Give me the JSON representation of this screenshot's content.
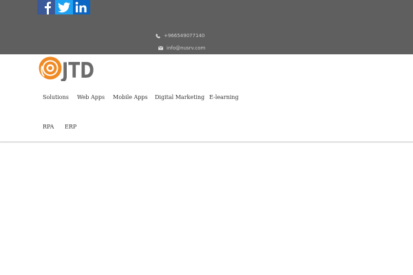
{
  "colors": {
    "topbar_bg": "#5f5f60",
    "facebook": "#3b5998",
    "twitter": "#1da1f2",
    "linkedin": "#0a66c2",
    "logo_orange": "#f08a24",
    "logo_grey": "#6b6b6b",
    "nav_text": "#333333"
  },
  "social": [
    {
      "name": "facebook",
      "icon": "facebook-icon"
    },
    {
      "name": "twitter",
      "icon": "twitter-icon"
    },
    {
      "name": "linkedin",
      "icon": "linkedin-icon"
    }
  ],
  "contact": {
    "phone": "+966549077140",
    "email": "info@nusrv.com",
    "phone_icon": "phone-icon",
    "email_icon": "envelope-icon"
  },
  "logo": {
    "text": "JTD"
  },
  "nav": {
    "items": [
      {
        "label": "Solutions"
      },
      {
        "label": "Web Apps"
      },
      {
        "label": "Mobile Apps"
      },
      {
        "label": "Digital Marketing"
      },
      {
        "label": "E-learning"
      },
      {
        "label": "RPA"
      },
      {
        "label": "ERP"
      }
    ]
  }
}
